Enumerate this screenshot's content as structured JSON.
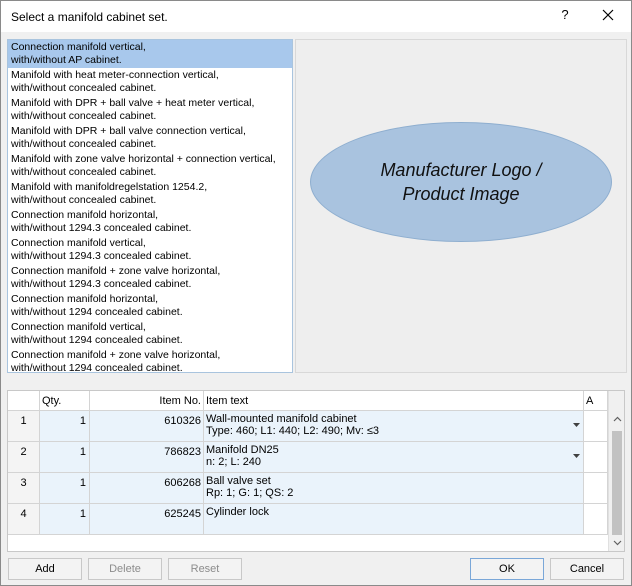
{
  "dialog": {
    "title": "Select a manifold cabinet set.",
    "help_label": "?"
  },
  "cabinet_list": {
    "items": [
      {
        "line1": "Connection manifold vertical,",
        "line2": "with/without AP cabinet.",
        "selected": true
      },
      {
        "line1": "Manifold with heat meter-connection vertical,",
        "line2": "with/without concealed cabinet."
      },
      {
        "line1": "Manifold with DPR + ball valve  + heat meter vertical,",
        "line2": "with/without concealed cabinet."
      },
      {
        "line1": "Manifold with DPR + ball valve connection vertical,",
        "line2": "with/without concealed cabinet."
      },
      {
        "line1": "Manifold with zone valve horizontal  + connection vertical,",
        "line2": "with/without concealed cabinet."
      },
      {
        "line1": "Manifold with manifoldregelstation 1254.2,",
        "line2": "with/without concealed cabinet."
      },
      {
        "line1": "Connection manifold horizontal,",
        "line2": "with/without 1294.3 concealed cabinet."
      },
      {
        "line1": "Connection manifold vertical,",
        "line2": "with/without 1294.3 concealed cabinet."
      },
      {
        "line1": "Connection manifold +  zone valve horizontal,",
        "line2": "with/without 1294.3 concealed cabinet."
      },
      {
        "line1": "Connection manifold horizontal,",
        "line2": "with/without 1294 concealed cabinet."
      },
      {
        "line1": "Connection manifold vertical,",
        "line2": "with/without 1294 concealed cabinet."
      },
      {
        "line1": "Connection manifold +  zone valve horizontal,",
        "line2": "with/without 1294 concealed cabinet."
      }
    ]
  },
  "image_panel": {
    "line1": "Manufacturer Logo /",
    "line2": "Product Image"
  },
  "grid": {
    "headers": {
      "num": "",
      "qty": "Qty.",
      "item_no": "Item No.",
      "item_text": "Item text",
      "a": "A"
    },
    "rows": [
      {
        "num": "1",
        "qty": "1",
        "item_no": "610326",
        "text1": "Wall-mounted manifold cabinet",
        "text2": "Type: 460;  L1: 440;  L2: 490;  Mv: ≤3",
        "dropdown": true
      },
      {
        "num": "2",
        "qty": "1",
        "item_no": "786823",
        "text1": "Manifold DN25",
        "text2": "n: 2;  L: 240",
        "dropdown": true
      },
      {
        "num": "3",
        "qty": "1",
        "item_no": "606268",
        "text1": "Ball valve set",
        "text2": "Rp: 1;  G: 1;  QS: 2",
        "dropdown": false
      },
      {
        "num": "4",
        "qty": "1",
        "item_no": "625245",
        "text1": "Cylinder lock",
        "text2": "",
        "dropdown": false
      }
    ]
  },
  "buttons": {
    "add": "Add",
    "delete": "Delete",
    "reset": "Reset",
    "ok": "OK",
    "cancel": "Cancel"
  },
  "colors": {
    "selection": "#a8c8ec",
    "logo_fill": "#a9c3df",
    "grid_editable": "#eaf3fb"
  }
}
